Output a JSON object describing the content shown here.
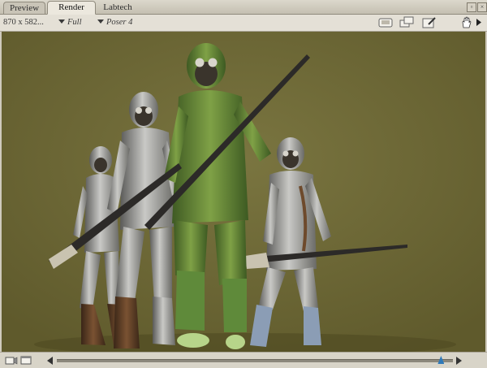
{
  "tabs": {
    "preview": "Preview",
    "render": "Render",
    "labtech": "Labtech"
  },
  "toolbar": {
    "render_size": "870 x 582...",
    "render_mode": "Full",
    "renderer": "Poser 4"
  },
  "icons": {
    "toolbar_right": [
      "render-settings-icon",
      "render-to-new-window-icon",
      "edit-icon",
      "hand-icon",
      "panel-arrow-icon"
    ],
    "bottom_left": [
      "camera-icon",
      "window-icon"
    ]
  },
  "timeline": {
    "position": 0.97
  },
  "colors": {
    "background": "#6f6a37",
    "panel": "#e4e0d6"
  }
}
